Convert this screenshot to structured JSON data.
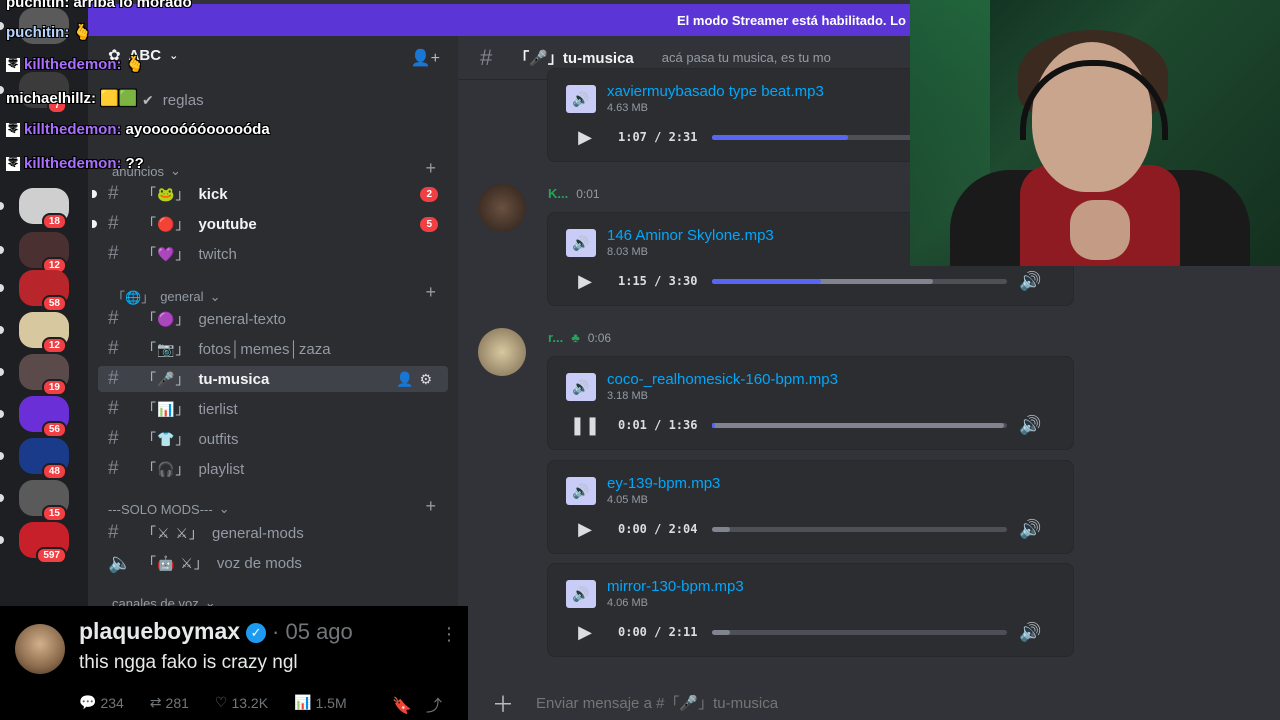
{
  "banner": {
    "text": "El modo Streamer está habilitado. Lo"
  },
  "server": {
    "name": "ABC",
    "rail_badges": [
      "7",
      "18",
      "12",
      "58",
      "12",
      "19",
      "56",
      "48",
      "15",
      "597"
    ],
    "rail_colors": [
      "#5a5a5a",
      "#3b3b3b",
      "#cfcfcf",
      "#4a3030",
      "#b8252a",
      "#d8c8a0",
      "#5a4a4a",
      "#6a2fd6",
      "#1a3a8a",
      "#5a5a5a",
      "#c8202a"
    ]
  },
  "sidebar": {
    "top_channel": {
      "deco": "✔",
      "name": "reglas"
    },
    "categories": {
      "anuncios": "anuncios",
      "general": "general",
      "solo_mods": "---SOLO MODS---",
      "voz": "canales de voz"
    },
    "channels": [
      {
        "deco": "「🐸」",
        "name": "kick",
        "count": "2"
      },
      {
        "deco": "「🔴」",
        "name": "youtube",
        "count": "5"
      },
      {
        "deco": "「💜」",
        "name": "twitch"
      },
      {
        "deco": "「🟣」",
        "name": "general-texto"
      },
      {
        "deco": "「📷」",
        "name": "fotos│memes│zaza"
      },
      {
        "deco": "「🎤」",
        "name": "tu-musica"
      },
      {
        "deco": "「📊」",
        "name": "tierlist"
      },
      {
        "deco": "「👕」",
        "name": "outfits"
      },
      {
        "deco": "「🎧」",
        "name": "playlist"
      },
      {
        "deco": "「⚔ ⚔」",
        "name": "general-mods"
      },
      {
        "deco": "「🤖 ⚔」",
        "name": "voz de mods"
      }
    ]
  },
  "main": {
    "channel_title": "「🎤」tu-musica",
    "channel_desc": "acá pasa tu musica, es tu mo",
    "messages": [
      {
        "user": "K...",
        "time": "0:01"
      },
      {
        "user": "r...",
        "time": "0:06"
      }
    ],
    "files": [
      {
        "name": "xaviermuybasado type beat.mp3",
        "size": "4.63 MB",
        "time": "1:07 / 2:31",
        "progress": 0.46,
        "buffered": 0.46,
        "state": "play"
      },
      {
        "name": "146 Aminor Skylone.mp3",
        "size": "8.03 MB",
        "time": "1:15 / 3:30",
        "progress": 0.37,
        "buffered": 0.75,
        "state": "play"
      },
      {
        "name": "coco-_realhomesick-160-bpm.mp3",
        "size": "3.18 MB",
        "time": "0:01 / 1:36",
        "progress": 0.01,
        "buffered": 0.99,
        "state": "pause"
      },
      {
        "name": "ey-139-bpm.mp3",
        "size": "4.05 MB",
        "time": "0:00 / 2:04",
        "progress": 0.0,
        "buffered": 0.06,
        "state": "play"
      },
      {
        "name": "mirror-130-bpm.mp3",
        "size": "4.06 MB",
        "time": "0:00 / 2:11",
        "progress": 0.0,
        "buffered": 0.06,
        "state": "play"
      }
    ],
    "composer_placeholder": "Enviar mensaje a #「🎤」tu-musica"
  },
  "chat": [
    {
      "user": "puchitin:",
      "msg": "arriba lo morado",
      "color": "#ffffff",
      "badge": false
    },
    {
      "user": "puchitin:",
      "msg": "🫰",
      "color": "#b7d4ff",
      "badge": false
    },
    {
      "user": "killthedemon:",
      "msg": "🫰",
      "color": "#a970ff",
      "badge": true
    },
    {
      "user": "michaelhillz:",
      "msg": "",
      "color": "#ffffff",
      "badge": false
    },
    {
      "user": "killthedemon:",
      "msg": "ayooooóóóooooóda",
      "color": "#a970ff",
      "badge": true
    },
    {
      "user": "killthedemon:",
      "msg": "??",
      "color": "#a970ff",
      "badge": true
    }
  ],
  "tweet": {
    "name": "plaqueboymax",
    "ago": "· 05 ago",
    "text": "this ngga fako is crazy ngl",
    "replies": "234",
    "retweets": "281",
    "likes": "13.2K",
    "views": "1.5M"
  }
}
